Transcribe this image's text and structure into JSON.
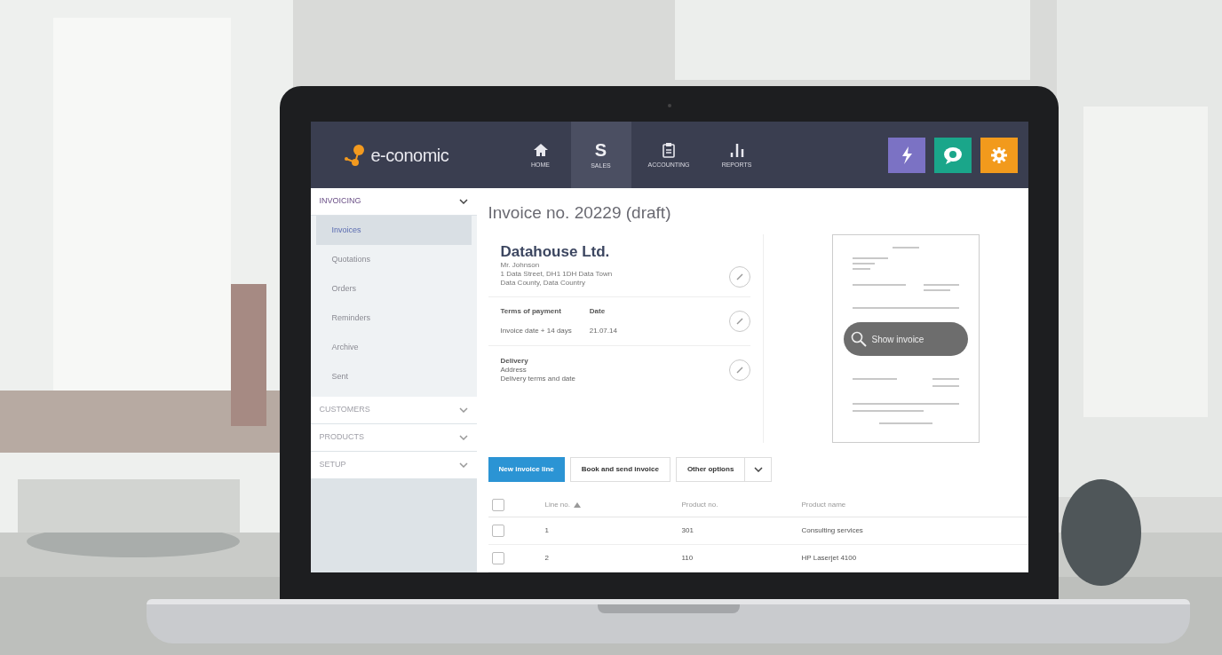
{
  "app": {
    "logo": "e-conomic"
  },
  "nav": [
    {
      "label": "HOME",
      "selected": false
    },
    {
      "label": "SALES",
      "glyph": "S",
      "selected": true
    },
    {
      "label": "ACCOUNTING",
      "selected": false
    },
    {
      "label": "REPORTS",
      "selected": false
    }
  ],
  "sidebar": [
    {
      "label": "INVOICING",
      "expanded": true,
      "items": [
        {
          "label": "Invoices",
          "selected": true
        },
        {
          "label": "Quotations",
          "selected": false
        },
        {
          "label": "Orders",
          "selected": false
        },
        {
          "label": "Reminders",
          "selected": false
        },
        {
          "label": "Archive",
          "selected": false
        },
        {
          "label": "Sent",
          "selected": false
        }
      ]
    },
    {
      "label": "CUSTOMERS",
      "expanded": false
    },
    {
      "label": "PRODUCTS",
      "expanded": false
    },
    {
      "label": "SETUP",
      "expanded": false
    }
  ],
  "main": {
    "title": "Invoice no. 20229 (draft)",
    "customer": {
      "name": "Datahouse Ltd.",
      "lines": [
        "Mr. Johnson",
        "1 Data Street, DH1 1DH Data Town",
        "Data County, Data Country"
      ]
    },
    "terms": {
      "headings": [
        "Terms of payment",
        "Date"
      ],
      "values": [
        "Invoice date + 14 days",
        "21.07.14"
      ]
    },
    "delivery": {
      "heading": "Delivery",
      "lines": [
        "Address",
        "Delivery terms and date"
      ]
    },
    "preview": {
      "button": "Show invoice"
    },
    "buttons": [
      {
        "label": "New invoice line",
        "kind": "primary"
      },
      {
        "label": "Book and send invoice",
        "kind": "default"
      },
      {
        "label": "Other options",
        "kind": "split"
      }
    ],
    "table": {
      "all_checked": false,
      "columns": [
        "Line no.",
        "Product no.",
        "Product name"
      ],
      "rows": [
        {
          "checked": false,
          "cells": [
            "1",
            "301",
            "Consulting services"
          ]
        },
        {
          "checked": false,
          "cells": [
            "2",
            "110",
            "HP Laserjet 4100"
          ]
        }
      ]
    }
  }
}
